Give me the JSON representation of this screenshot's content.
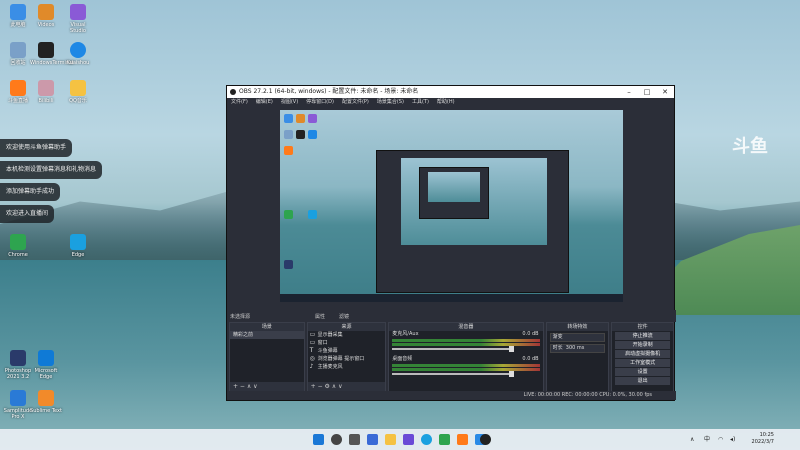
{
  "desktop_icons": [
    {
      "label": "此电脑",
      "color": "#3a8ee6"
    },
    {
      "label": "Videos",
      "color": "#e08a2a"
    },
    {
      "label": "Visual Studio",
      "color": "#8a5ad6"
    },
    {
      "label": "回收站",
      "color": "#7aa0c8"
    },
    {
      "label": "WindowsTerminal",
      "color": "#222"
    },
    {
      "label": "Kuaishou",
      "color": "#1e88e5"
    },
    {
      "label": "斗鱼直播",
      "color": "#ff7a1a"
    },
    {
      "label": "Bilibili",
      "color": "#c9a"
    },
    {
      "label": "QQ音乐",
      "color": "#f5c242"
    },
    {
      "label": "Chrome",
      "color": "#2ea44f"
    },
    {
      "label": "Edge",
      "color": "#1aa0e0"
    },
    {
      "label": "Photoshop 2021 3.2",
      "color": "#2a3a6a"
    },
    {
      "label": "Microsoft Edge",
      "color": "#0f7ad6"
    },
    {
      "label": "Samplitude Pro X",
      "color": "#2a7ad6"
    },
    {
      "label": "Sublime Text",
      "color": "#f28a2a"
    }
  ],
  "toasts": [
    "欢迎使用斗鱼弹幕助手",
    "本机检测设置弹幕消息和礼物消息",
    "添加弹幕助手成功",
    "欢迎进入直播间"
  ],
  "douyu_logo": "斗鱼",
  "obs": {
    "title": "OBS 27.2.1 (64-bit, windows) - 配置文件: 未命名 - 场景: 未命名",
    "menu": [
      "文件(F)",
      "编辑(E)",
      "视图(V)",
      "停靠窗口(D)",
      "配置文件(P)",
      "场景集合(S)",
      "工具(T)",
      "帮助(H)"
    ],
    "mode_label": "未选择源",
    "mode_buttons": [
      "属性",
      "滤镜"
    ],
    "panels": {
      "scenes": {
        "header": "场景",
        "items": [
          "精彩之前"
        ]
      },
      "sources": {
        "header": "来源",
        "items": [
          "显示器采集",
          "窗口",
          "斗鱼弹幕",
          "浏览器弹幕 提示窗口",
          "主播麦克风"
        ]
      },
      "mixer": {
        "header": "混音器",
        "channels": [
          {
            "name": "麦克风/Aux",
            "db": "0.0 dB"
          },
          {
            "name": "桌面音频",
            "db": "0.0 dB"
          }
        ]
      },
      "transitions": {
        "header": "转场特效",
        "type": "渐变",
        "duration_label": "时长",
        "duration": "300 ms"
      },
      "controls": {
        "header": "控件",
        "buttons": [
          "停止推流",
          "开始录制",
          "启动虚拟摄像机",
          "工作室模式",
          "设置",
          "退出"
        ]
      }
    },
    "status": "LIVE: 00:00:00   REC: 00:00:00   CPU: 0.0%, 30.00 fps"
  },
  "taskbar": {
    "clock_time": "10:25",
    "clock_date": "2022/3/7",
    "tray_lang": "中"
  }
}
